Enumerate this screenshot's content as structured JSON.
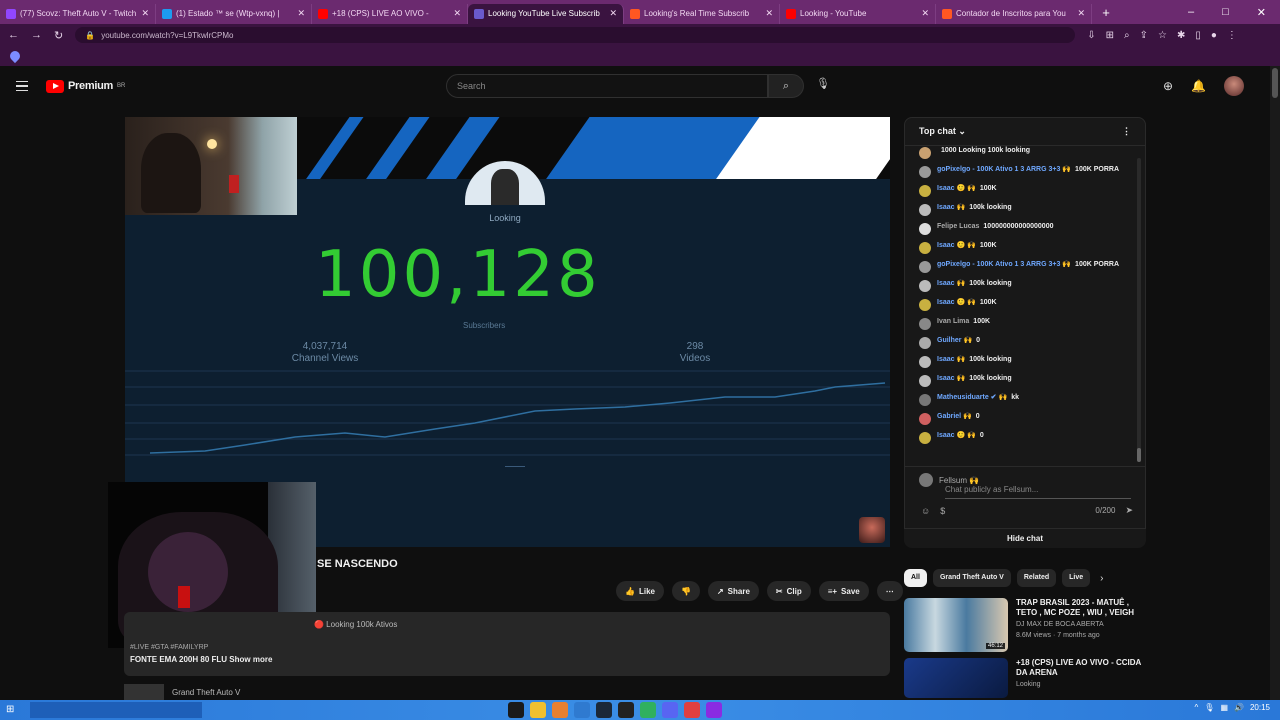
{
  "browser": {
    "tabs": [
      {
        "title": "(77) Scovz: Theft Auto V - Twitch",
        "color": "#9146ff"
      },
      {
        "title": "(1) Estado ™ se (Wtp-vxnq) |",
        "color": "#1d9bf0"
      },
      {
        "title": "+18 (CPS) LIVE AO VIVO - ",
        "color": "#ff0000"
      },
      {
        "title": "Looking YouTube Live Subscrib",
        "color": "#6a5acd",
        "active": true
      },
      {
        "title": "Looking's Real Time Subscrib",
        "color": "#ff5722"
      },
      {
        "title": "Looking - YouTube",
        "color": "#ff0000"
      },
      {
        "title": "Contador de Inscritos para You",
        "color": "#ff5722"
      }
    ],
    "new_tab_label": "+",
    "url": "youtube.com/watch?v=L9TkwlrCPMo",
    "window_controls": [
      "–",
      "□",
      "✕"
    ]
  },
  "youtube": {
    "logo_text": "Premium",
    "logo_sup": "BR",
    "search_placeholder": "Search"
  },
  "player": {
    "channel_name": "Looking",
    "counter_text": "100,128",
    "sub_label": "Subscribers",
    "left_stat_value": "4,037,714",
    "left_stat_label": "Channel Views",
    "right_stat_value": "298",
    "right_stat_label": "Videos",
    "graph_line_color": "#2f6fa0"
  },
  "video": {
    "title_visible": "SE NASCENDO",
    "actions": [
      {
        "icon": "👍",
        "label": "Like"
      },
      {
        "icon": "👎",
        "label": ""
      },
      {
        "icon": "↗",
        "label": "Share"
      },
      {
        "icon": "✂",
        "label": "Clip"
      },
      {
        "icon": "≡+",
        "label": "Save"
      },
      {
        "icon": "⋯",
        "label": ""
      }
    ],
    "desc_meta": "🔴 Looking 100k Ativos",
    "desc_hashtags": "#LIVE #GTA #FAMILYRP",
    "desc_line": "FONTE EMA 200H 80 FLU",
    "show_more": "Show more",
    "game_name": "Grand Theft Auto V"
  },
  "chat": {
    "header": "Top chat",
    "messages": [
      {
        "author": "",
        "text": "1000 Looking 100k looking",
        "av": "#c8a070"
      },
      {
        "author": "goPixelgo - 100K Ativo 1 3 ARRG 3+3 🙌",
        "text": "100K PORRA",
        "av": "#999"
      },
      {
        "author": "Isaac 🙂 🙌",
        "text": "100K",
        "av": "#c8b040"
      },
      {
        "author": "Isaac 🙌",
        "text": "100k looking",
        "av": "#bbb"
      },
      {
        "author": "Felipe Lucas",
        "text": "100000000000000000",
        "av": "#ddd",
        "gray": true
      },
      {
        "author": "Isaac 🙂 🙌",
        "text": "100K",
        "av": "#c8b040"
      },
      {
        "author": "goPixelgo - 100K Ativo 1 3 ARRG 3+3 🙌",
        "text": "100K PORRA",
        "av": "#999"
      },
      {
        "author": "Isaac 🙌",
        "text": "100k looking",
        "av": "#bbb"
      },
      {
        "author": "Isaac 🙂 🙌",
        "text": "100K",
        "av": "#c8b040"
      },
      {
        "author": "Ivan Lima",
        "text": "100K",
        "av": "#888",
        "gray": true
      },
      {
        "author": "Guilher 🙌",
        "text": "0",
        "av": "#aaa"
      },
      {
        "author": "Isaac 🙌",
        "text": "100k looking",
        "av": "#bbb"
      },
      {
        "author": "Isaac 🙌",
        "text": "100k looking",
        "av": "#bbb"
      },
      {
        "author": "Matheusiduarte ✔ 🙌",
        "text": "kk",
        "av": "#777"
      },
      {
        "author": "Gabriel 🙌",
        "text": "0",
        "av": "#d06060"
      },
      {
        "author": "Isaac 🙂 🙌",
        "text": "0",
        "av": "#c8b040"
      }
    ],
    "input_user": "Fellsum 🙌",
    "input_placeholder": "Chat publicly as Fellsum...",
    "char_count": "0/200",
    "hide_label": "Hide chat"
  },
  "chips": [
    {
      "label": "All",
      "active": true
    },
    {
      "label": "Grand Theft Auto V"
    },
    {
      "label": "Related"
    },
    {
      "label": "Live"
    }
  ],
  "recommendations": [
    {
      "title": "TRAP BRASIL 2023 - MATUÊ , TETO , MC POZE , WIU , VEIGH",
      "channel": "DJ MAX DE BOCA ABERTA",
      "views": "8.6M views · 7 months ago",
      "duration": "46:12",
      "color": "#4a7aa0"
    },
    {
      "title": "+18 (CPS) LIVE AO VIVO - CCIDA DA ARENA",
      "channel": "Looking",
      "views": "",
      "duration": "",
      "color": "#1a3a8a"
    }
  ]
}
